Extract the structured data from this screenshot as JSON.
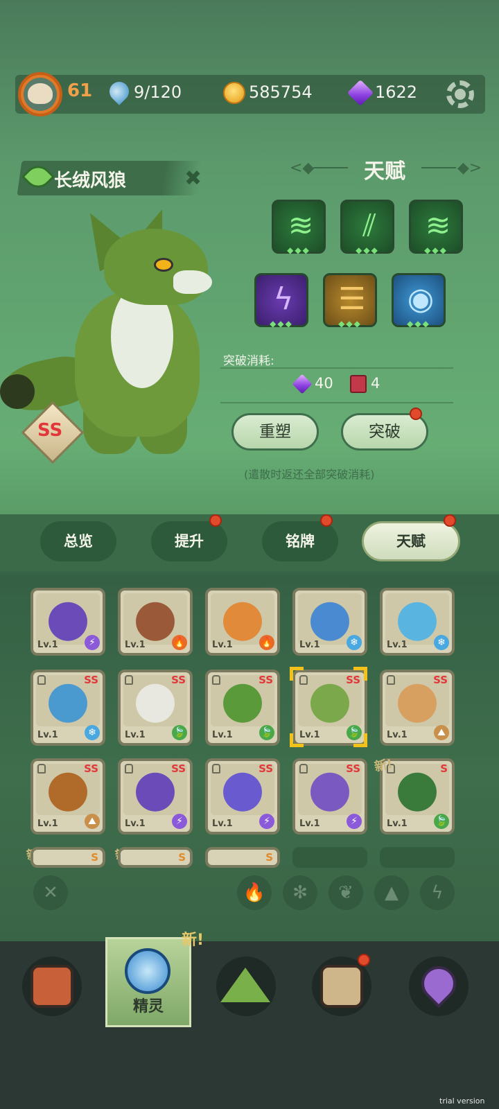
{
  "header": {
    "player_level": "61",
    "stamina": "9/120",
    "coins": "585754",
    "gems": "1622",
    "icons": [
      "avatar",
      "water-drop-icon",
      "paw-coin-icon",
      "purple-gem-icon",
      "gear-icon"
    ]
  },
  "pet": {
    "name": "长绒风狼",
    "rank": "SS",
    "element": "grass"
  },
  "talent": {
    "title": "天赋",
    "slots": [
      {
        "icon": "claw-swirl-icon",
        "color": "green",
        "dots": "◆◆◆"
      },
      {
        "icon": "claw-slash-icon",
        "color": "green",
        "dots": "◆◆◆"
      },
      {
        "icon": "claw-swirl-icon",
        "color": "green",
        "dots": "◆◆◆"
      },
      {
        "icon": "lightning-icon",
        "color": "purple",
        "dots": "◆◆◆"
      },
      {
        "icon": "rock-layers-icon",
        "color": "gold",
        "dots": "◆◆◆"
      },
      {
        "icon": "eye-icon",
        "color": "blue",
        "dots": "◆◆◆"
      }
    ],
    "break_label": "突破消耗:",
    "cost_gems": "40",
    "cost_books": "4",
    "reshape_button": "重塑",
    "break_button": "突破",
    "note": "(遣散时返还全部突破消耗)"
  },
  "tabs": [
    {
      "label": "总览",
      "badge": false
    },
    {
      "label": "提升",
      "badge": true
    },
    {
      "label": "铭牌",
      "badge": true
    },
    {
      "label": "天赋",
      "badge": true,
      "active": true
    }
  ],
  "grid": {
    "rows": [
      [
        {
          "lv": "Lv.1",
          "rank": "",
          "elem": "⚡",
          "color": "#6a4bb8"
        },
        {
          "lv": "Lv.1",
          "rank": "",
          "elem": "🔥",
          "color": "#9a5a3a"
        },
        {
          "lv": "Lv.1",
          "rank": "",
          "elem": "🔥",
          "color": "#e08a3a"
        },
        {
          "lv": "Lv.1",
          "rank": "",
          "elem": "❄",
          "color": "#4a8ad0"
        },
        {
          "lv": "Lv.1",
          "rank": "",
          "elem": "❄",
          "color": "#5ab4e0"
        }
      ],
      [
        {
          "lv": "Lv.1",
          "rank": "SS",
          "elem": "❄",
          "color": "#4a9ad0"
        },
        {
          "lv": "Lv.1",
          "rank": "SS",
          "elem": "🍃",
          "color": "#e8e8e0"
        },
        {
          "lv": "Lv.1",
          "rank": "SS",
          "elem": "🍃",
          "color": "#5a9a3a"
        },
        {
          "lv": "Lv.1",
          "rank": "SS",
          "elem": "🍃",
          "color": "#7aa84a"
        },
        {
          "lv": "Lv.1",
          "rank": "SS",
          "elem": "⛰",
          "color": "#d8a060"
        }
      ],
      [
        {
          "lv": "Lv.1",
          "rank": "SS",
          "elem": "⛰",
          "color": "#b06a2a"
        },
        {
          "lv": "Lv.1",
          "rank": "SS",
          "elem": "⚡",
          "color": "#6a4bb8"
        },
        {
          "lv": "Lv.1",
          "rank": "SS",
          "elem": "⚡",
          "color": "#6a5ad0"
        },
        {
          "lv": "Lv.1",
          "rank": "SS",
          "elem": "⚡",
          "color": "#7a5ac0"
        },
        {
          "lv": "Lv.1",
          "rank": "S",
          "elem": "🍃",
          "color": "#3a7a3a"
        }
      ]
    ],
    "partial_row": [
      {
        "rank": "S"
      },
      {
        "rank": "S"
      },
      {
        "rank": "S"
      }
    ],
    "new_tag": "新!"
  },
  "filters": [
    "✕",
    "fire-icon",
    "snowflake-icon",
    "leaf-icon",
    "rock-icon",
    "lightning-icon"
  ],
  "bottom_nav": {
    "active_label": "精灵",
    "new_tag": "新!",
    "items": [
      "console-icon",
      "spirit-icon",
      "mountain-icon",
      "chest-icon",
      "map-pin-icon"
    ]
  },
  "watermark": "trial version"
}
